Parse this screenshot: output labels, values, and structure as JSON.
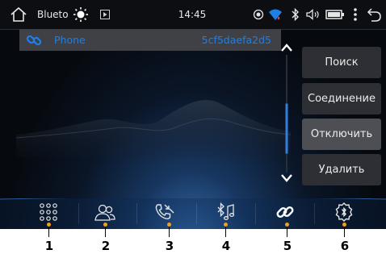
{
  "status_bar": {
    "app_label": "Blueto",
    "time": "14:45"
  },
  "device": {
    "name": "Phone",
    "address": "5cf5daefa2d5"
  },
  "scroll": {
    "position_fraction": 0.72
  },
  "actions": {
    "search": "Поиск",
    "connect": "Соединение",
    "disconnect": "Отключить",
    "delete": "Удалить"
  },
  "nav": {
    "labels": [
      "1",
      "2",
      "3",
      "4",
      "5",
      "6"
    ],
    "icons": [
      "apps-grid-icon",
      "contacts-icon",
      "call-log-icon",
      "bluetooth-music-icon",
      "link-icon",
      "settings-icon"
    ]
  },
  "colors": {
    "accent": "#1f7fe6",
    "highlight": "#f0a020"
  }
}
